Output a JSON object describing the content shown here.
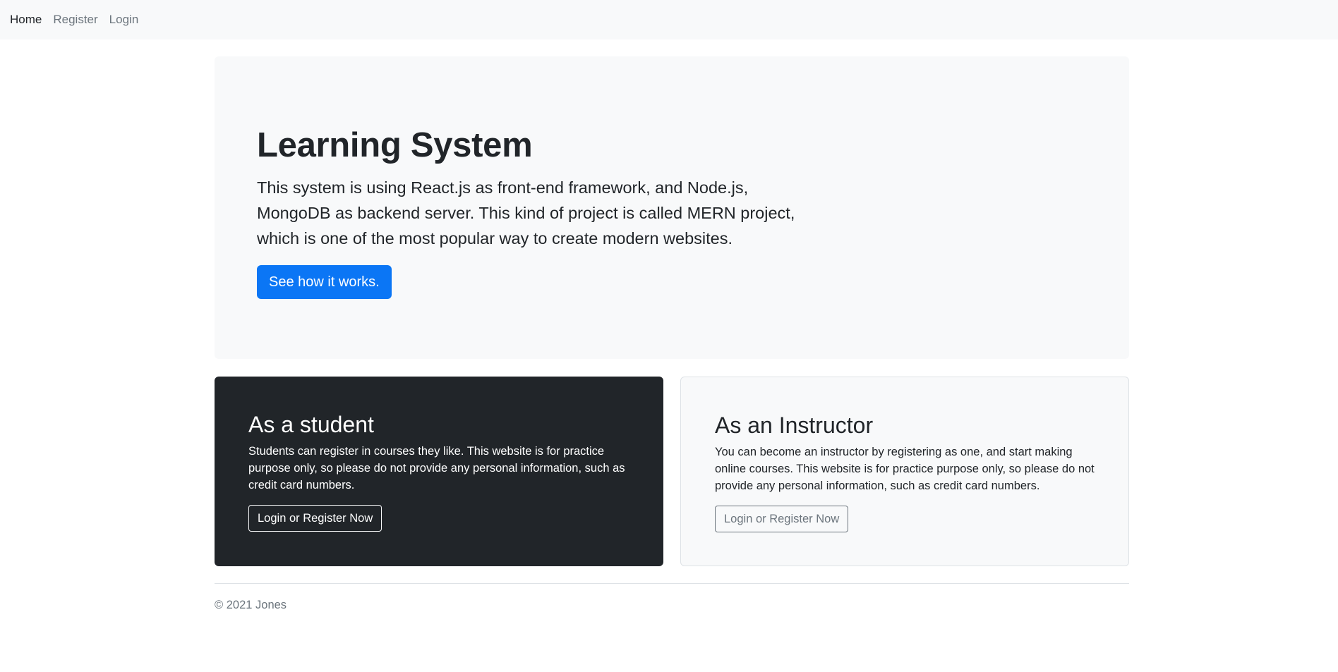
{
  "nav": {
    "items": [
      {
        "label": "Home"
      },
      {
        "label": "Register"
      },
      {
        "label": "Login"
      }
    ]
  },
  "hero": {
    "title": "Learning System",
    "lead": "This system is using React.js as front-end framework, and Node.js, MongoDB as backend server. This kind of project is called MERN project, which is one of the most popular way to create modern websites.",
    "button_label": "See how it works."
  },
  "cards": {
    "student": {
      "title": "As a student",
      "text": "Students can register in courses they like. This website is for practice purpose only, so please do not provide any personal information, such as credit card numbers.",
      "button_label": "Login or Register Now"
    },
    "instructor": {
      "title": "As an Instructor",
      "text": "You can become an instructor by registering as one, and start making online courses. This website is for practice purpose only, so please do not provide any personal information, such as credit card numbers.",
      "button_label": "Login or Register Now"
    }
  },
  "footer": {
    "text": "© 2021 Jones"
  },
  "colors": {
    "primary": "#0b76f5",
    "dark": "#212529",
    "light": "#f8f9fa",
    "muted": "#6c757d"
  }
}
